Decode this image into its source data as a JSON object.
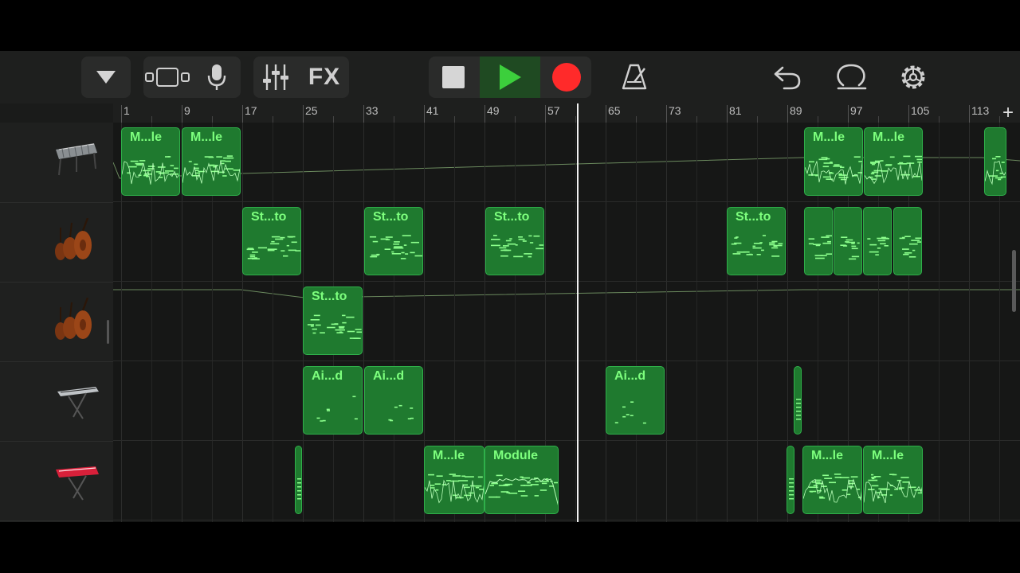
{
  "toolbar": {
    "view_dropdown_icon": "triangle-down-icon",
    "tracks_view_icon": "tracks-view-icon",
    "mic_icon": "microphone-icon",
    "mixer_icon": "mixer-sliders-icon",
    "fx_label": "FX",
    "stop_icon": "stop-icon",
    "play_icon": "play-icon",
    "record_icon": "record-icon",
    "metronome_icon": "metronome-icon",
    "undo_icon": "undo-icon",
    "loop_icon": "loop-icon",
    "settings_icon": "gear-icon",
    "colors": {
      "play": "#3ccf3c",
      "record": "#ff2a2a",
      "region": "#1f7a2f",
      "region_text": "#7dff7d"
    }
  },
  "ruler": {
    "bars": [
      "1",
      "9",
      "17",
      "25",
      "33",
      "41",
      "49",
      "57",
      "65",
      "73",
      "81",
      "89",
      "97",
      "105",
      "113"
    ],
    "add_label": "+"
  },
  "tracks": [
    {
      "instrument": "vibraphone-icon"
    },
    {
      "instrument": "strings-icon"
    },
    {
      "instrument": "strings-icon"
    },
    {
      "instrument": "keyboard-icon"
    },
    {
      "instrument": "red-keyboard-icon"
    }
  ],
  "regions": [
    {
      "track": 0,
      "label": "M...le"
    },
    {
      "track": 0,
      "label": "M...le"
    },
    {
      "track": 0,
      "label": "M...le"
    },
    {
      "track": 0,
      "label": "M...le"
    },
    {
      "track": 0,
      "label": ""
    },
    {
      "track": 1,
      "label": "St...to"
    },
    {
      "track": 1,
      "label": "St...to"
    },
    {
      "track": 1,
      "label": "St...to"
    },
    {
      "track": 1,
      "label": "St...to"
    },
    {
      "track": 1,
      "label": ""
    },
    {
      "track": 1,
      "label": ""
    },
    {
      "track": 1,
      "label": ""
    },
    {
      "track": 1,
      "label": ""
    },
    {
      "track": 2,
      "label": "St...to"
    },
    {
      "track": 3,
      "label": "Ai...d"
    },
    {
      "track": 3,
      "label": "Ai...d"
    },
    {
      "track": 3,
      "label": "Ai...d"
    },
    {
      "track": 3,
      "label": ""
    },
    {
      "track": 4,
      "label": ""
    },
    {
      "track": 4,
      "label": "M...le"
    },
    {
      "track": 4,
      "label": "Module"
    },
    {
      "track": 4,
      "label": ""
    },
    {
      "track": 4,
      "label": "M...le"
    },
    {
      "track": 4,
      "label": "M...le"
    }
  ]
}
